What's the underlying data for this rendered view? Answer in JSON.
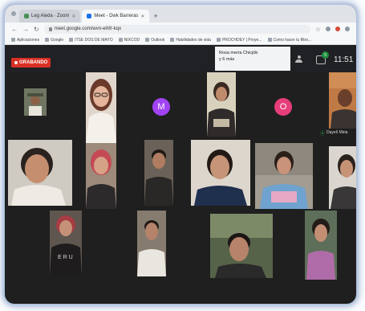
{
  "browser": {
    "tabs": [
      {
        "label": "Leg Aleda · Zoom"
      },
      {
        "label": "Meet - Dwk Barreras"
      }
    ],
    "new_tab": "+",
    "url": "meet.google.com/wvn-eihfr-kqx",
    "bookmarks": [
      "Aplicaciones",
      "Google",
      "ITSE DOS DE MAYO",
      "NIXCOD",
      "Outlook",
      "Habilidades de vida",
      "PROCHDEY | Proye...",
      "Como hacer tu filtro..."
    ]
  },
  "meet": {
    "recording_label": "GRABANDO",
    "presenter_line1": "Rosa mería Chicjób",
    "presenter_line2": "y 6 más",
    "chat_badge": "5",
    "clock": "11:51",
    "active_speaker": "Dayelí Miria",
    "avatar_m": "M",
    "avatar_o": "O"
  },
  "colors": {
    "accent": "#1a73e8",
    "recording": "#d93025",
    "avatar_m": "#a142f4",
    "avatar_o": "#e63e7b",
    "badge": "#1e8e3e"
  }
}
